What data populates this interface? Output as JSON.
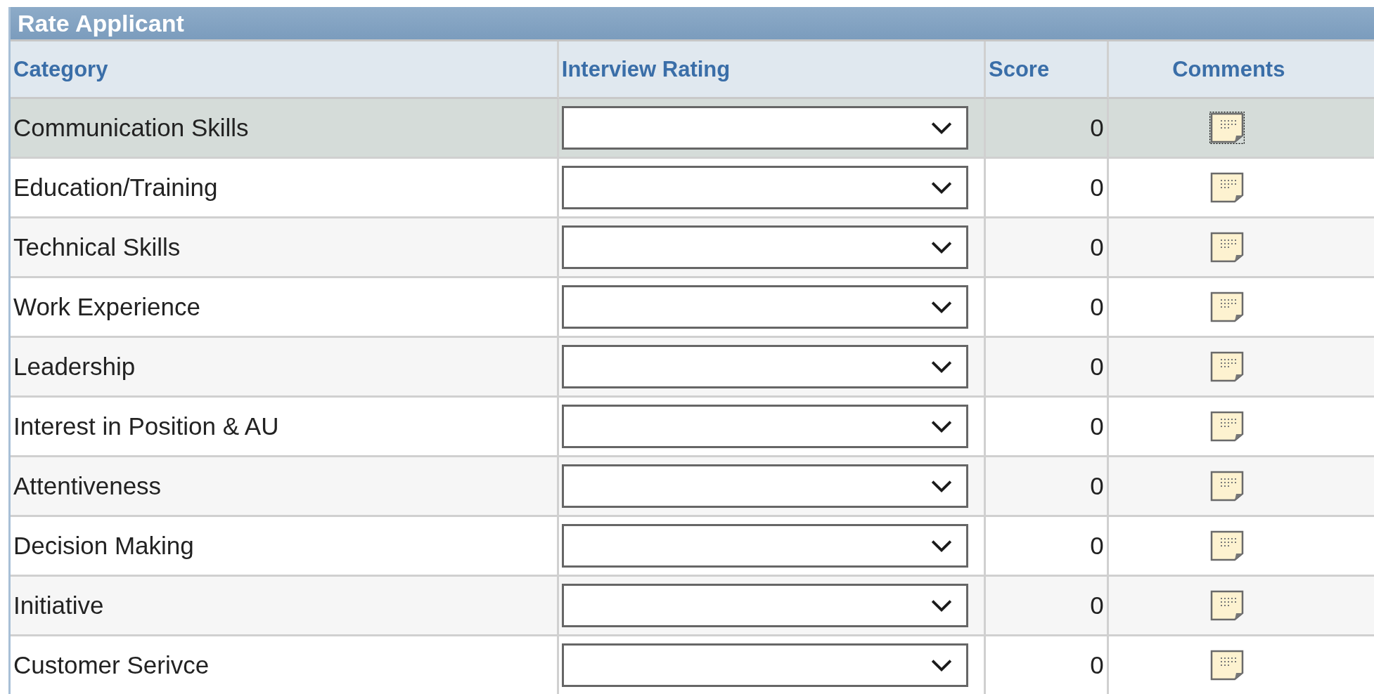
{
  "panel": {
    "title": "Rate Applicant"
  },
  "table": {
    "columns": [
      "Category",
      "Interview Rating",
      "Score",
      "Comments"
    ],
    "rows": [
      {
        "category": "Communication Skills",
        "score": "0",
        "selected": true
      },
      {
        "category": "Education/Training",
        "score": "0",
        "selected": false
      },
      {
        "category": "Technical Skills",
        "score": "0",
        "selected": false
      },
      {
        "category": "Work Experience",
        "score": "0",
        "selected": false
      },
      {
        "category": "Leadership",
        "score": "0",
        "selected": false
      },
      {
        "category": "Interest in Position & AU",
        "score": "0",
        "selected": false
      },
      {
        "category": "Attentiveness",
        "score": "0",
        "selected": false
      },
      {
        "category": "Decision Making",
        "score": "0",
        "selected": false
      },
      {
        "category": "Initiative",
        "score": "0",
        "selected": false
      },
      {
        "category": "Customer Serivce",
        "score": "0",
        "selected": false
      }
    ]
  }
}
